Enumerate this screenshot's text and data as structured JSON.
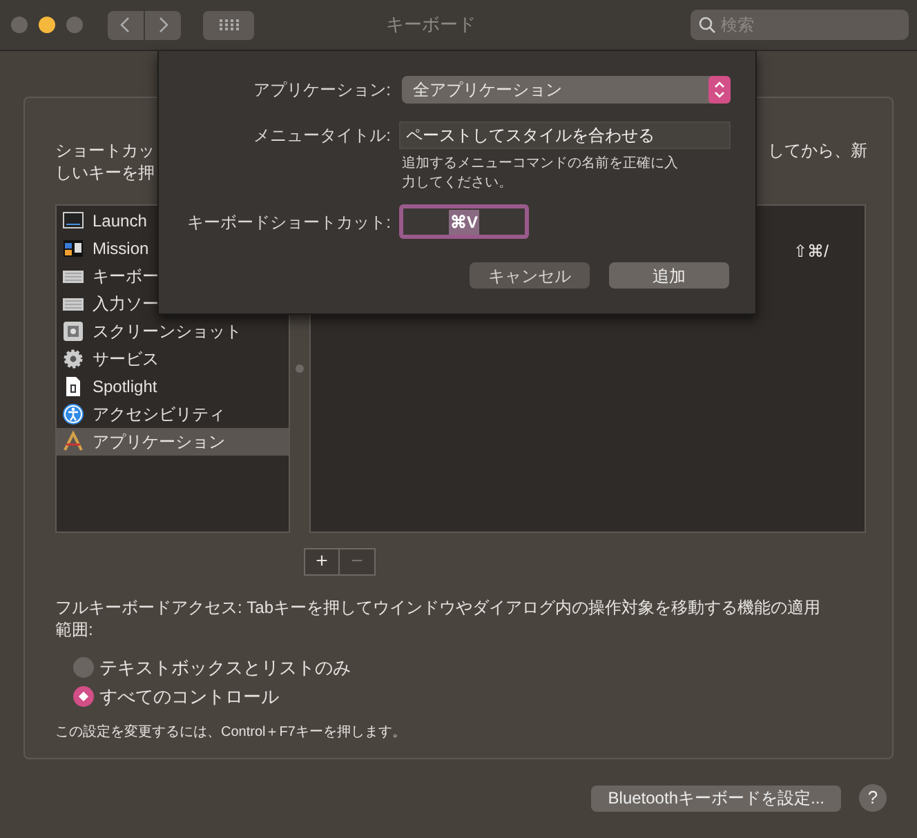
{
  "window": {
    "title": "キーボード",
    "search_placeholder": "検索"
  },
  "panel": {
    "instruction_left": [
      "ショートカッ",
      "しいキーを押"
    ],
    "instruction_right": "してから、新",
    "categories": [
      {
        "label": "Launch",
        "kind": "launchpad",
        "selected": false
      },
      {
        "label": "Mission",
        "kind": "mission",
        "selected": false
      },
      {
        "label": "キーボー",
        "kind": "keyboard",
        "selected": false
      },
      {
        "label": "入力ソー",
        "kind": "keyboard",
        "selected": false
      },
      {
        "label": "スクリーンショット",
        "kind": "screenshot",
        "selected": false
      },
      {
        "label": "サービス",
        "kind": "gear",
        "selected": false
      },
      {
        "label": "Spotlight",
        "kind": "spotlight",
        "selected": false
      },
      {
        "label": "アクセシビリティ",
        "kind": "accessibility",
        "selected": false
      },
      {
        "label": "アプリケーション",
        "kind": "app",
        "selected": true
      }
    ],
    "shortcuts": [
      {
        "keys": "⇧⌘/"
      }
    ],
    "add_button": "+",
    "remove_button": "−",
    "full_keyboard_access": {
      "description": "フルキーボードアクセス: Tabキーを押してウインドウやダイアログ内の操作対象を移動する機能の適用範囲:",
      "options": [
        {
          "label": "テキストボックスとリストのみ",
          "selected": false
        },
        {
          "label": "すべてのコントロール",
          "selected": true
        }
      ],
      "note": "この設定を変更するには、Control＋F7キーを押します。"
    }
  },
  "sheet": {
    "application_label": "アプリケーション:",
    "application_value": "全アプリケーション",
    "menu_title_label": "メニュータイトル:",
    "menu_title_value": "ペーストしてスタイルを合わせる",
    "hint": "追加するメニューコマンドの名前を正確に入力してください。",
    "shortcut_label": "キーボードショートカット:",
    "shortcut_value": "⌘V",
    "buttons": [
      {
        "label": "キャンセル",
        "kind": "cancel"
      },
      {
        "label": "追加",
        "kind": "default"
      }
    ]
  },
  "footer": {
    "bluetooth_button": "Bluetoothキーボードを設定...",
    "help_button": "?"
  }
}
